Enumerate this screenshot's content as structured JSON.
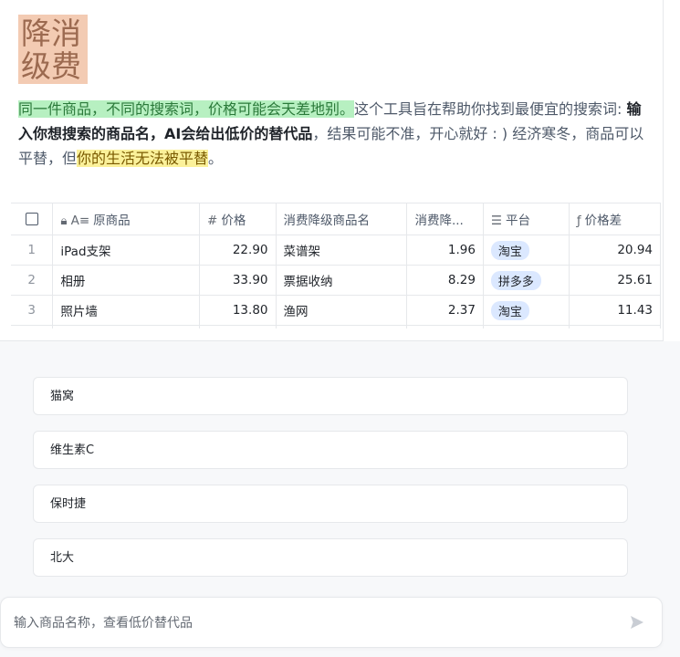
{
  "logo": {
    "line1": "降消",
    "line2": "级费"
  },
  "description": {
    "part1_highlight": "同一件商品，不同的搜索词，价格可能会天差地别。",
    "part2": "这个工具旨在帮助你找到最便宜的搜索词: ",
    "part3_bold": "输入你想搜索的商品名，AI会给出低价的替代品",
    "part4": "，结果可能不准，开心就好 : ) 经济寒冬，商品可以平替，但",
    "part5_highlight": "你的生活无法被平替",
    "part6": "。"
  },
  "table": {
    "headers": {
      "original": "原商品",
      "price": "价格",
      "downgrade_name": "消费降级商品名",
      "downgrade_price": "消费降...",
      "platform": "平台",
      "price_diff": "价格差"
    },
    "header_icons": {
      "original": "lock-icon + text-icon",
      "price": "number-icon",
      "platform": "list-icon",
      "price_diff": "formula-icon"
    },
    "rows": [
      {
        "index": "1",
        "original": "iPad支架",
        "price": "22.90",
        "downgrade_name": "菜谱架",
        "downgrade_price": "1.96",
        "platform": "淘宝",
        "price_diff": "20.94"
      },
      {
        "index": "2",
        "original": "相册",
        "price": "33.90",
        "downgrade_name": "票据收纳",
        "downgrade_price": "8.29",
        "platform": "拼多多",
        "price_diff": "25.61"
      },
      {
        "index": "3",
        "original": "照片墙",
        "price": "13.80",
        "downgrade_name": "渔网",
        "downgrade_price": "2.37",
        "platform": "淘宝",
        "price_diff": "11.43"
      }
    ]
  },
  "suggestions": [
    "猫窝",
    "维生素C",
    "保时捷",
    "北大"
  ],
  "input": {
    "placeholder": "输入商品名称，查看低价替代品",
    "value": ""
  },
  "colors": {
    "accent_tag": "#dbe8ff",
    "highlight_green": "#b7f0c1",
    "highlight_yellow": "#fbf19a",
    "logo_bg": "#f3cbb3"
  }
}
